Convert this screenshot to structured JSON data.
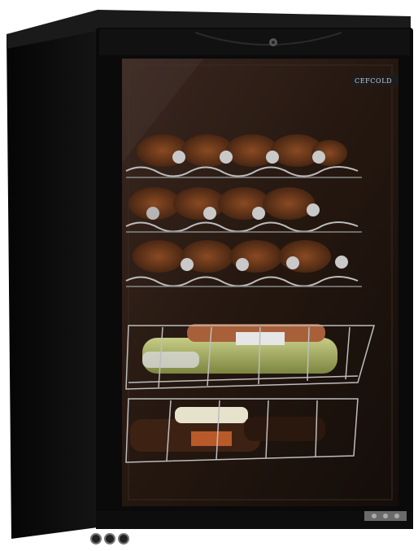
{
  "product": {
    "brand_label": "CEFCOLD",
    "colors": {
      "cabinet": "#0b0b0b",
      "glass_tint": "#2a1a14",
      "shelf_wire": "#bdbdbd",
      "bottle_amber": "#6a3a1e",
      "bottle_green": "#9aa25a",
      "background": "#ffffff"
    }
  }
}
